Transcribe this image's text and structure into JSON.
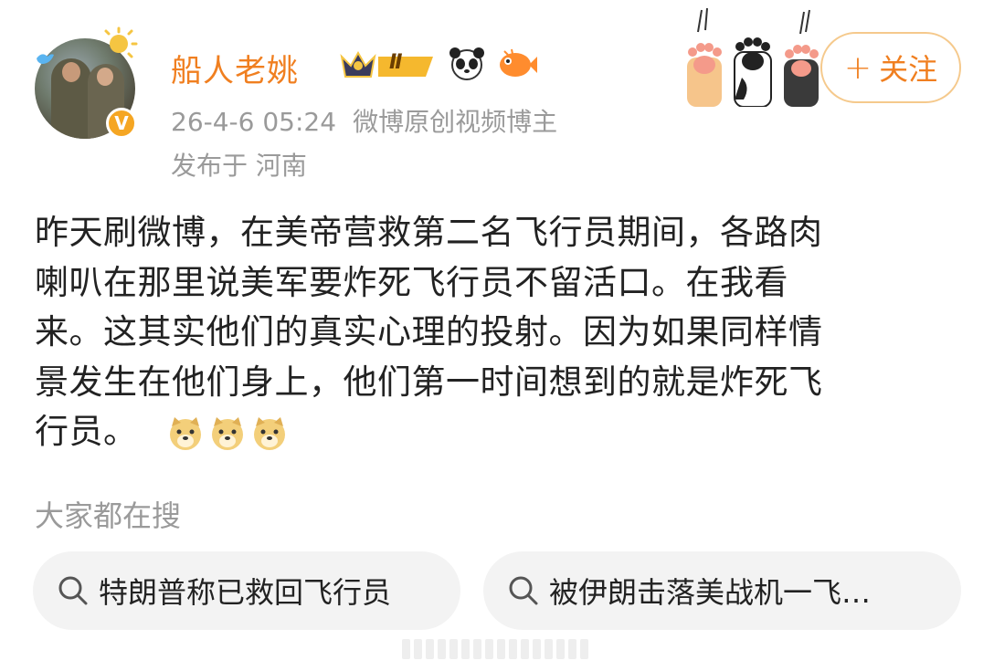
{
  "header": {
    "username": "船人老姚",
    "timestamp": "26-4-6 05:24",
    "source": "微博原创视频博主",
    "location": "发布于 河南",
    "badge_level": "Ⅱ",
    "badges": [
      "crown-level-badge",
      "panda-badge",
      "fish-badge"
    ],
    "verified_icon": "verified-v-badge",
    "follow_label": "关注",
    "follow_icon": "plus-icon"
  },
  "post": {
    "lines": [
      "昨天刷微博，在美帝营救第二名飞行员期间，各路肉",
      "喇叭在那里说美军要炸死飞行员不留活口。在我看",
      "来。这其实他们的真实心理的投射。因为如果同样情",
      "景发生在他们身上，他们第一时间想到的就是炸死飞",
      "行员。"
    ],
    "emojis": [
      "doge-emoji",
      "doge-emoji",
      "doge-emoji"
    ]
  },
  "trending": {
    "title": "大家都在搜",
    "items": [
      {
        "label": "特朗普称已救回飞行员",
        "icon": "search-icon"
      },
      {
        "label": "被伊朗击落美战机一飞…",
        "icon": "search-icon"
      }
    ]
  },
  "colors": {
    "accent": "#f07f20",
    "meta": "#9a9a9a",
    "chip_bg": "#f3f3f3",
    "text": "#222222"
  }
}
